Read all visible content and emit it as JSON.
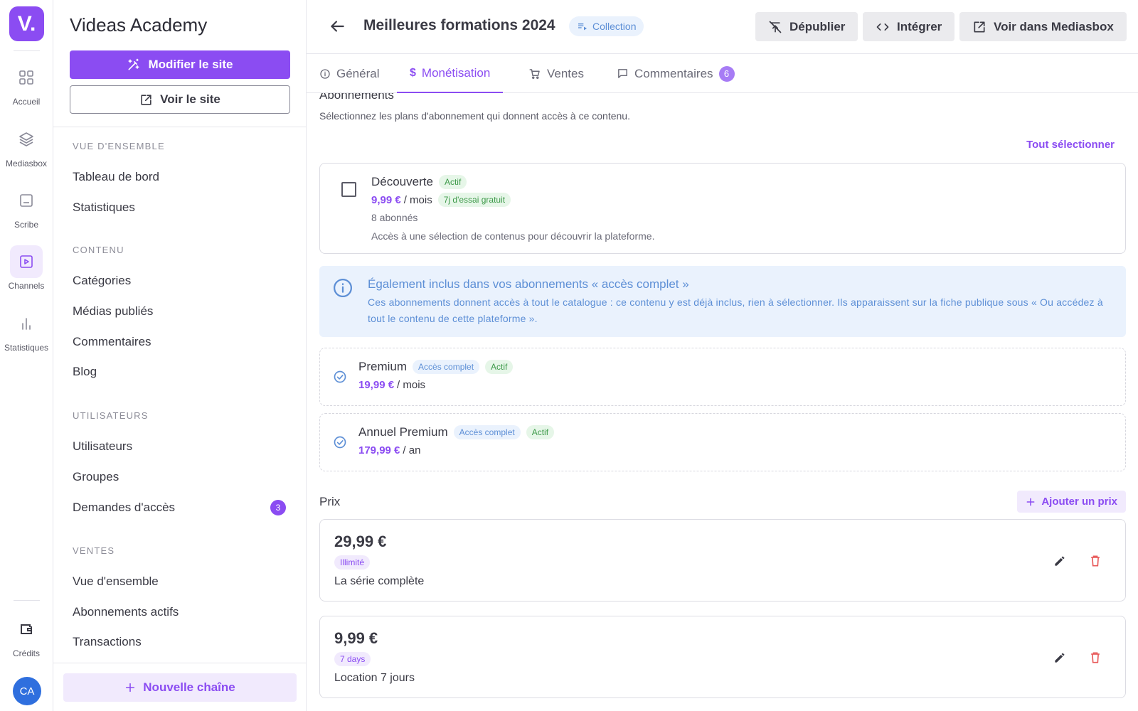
{
  "rail": {
    "logo": "V.",
    "items": [
      {
        "label": "Accueil",
        "icon": "grid-icon"
      },
      {
        "label": "Mediasbox",
        "icon": "layers-icon"
      },
      {
        "label": "Scribe",
        "icon": "caption-icon"
      },
      {
        "label": "Channels",
        "icon": "play-square-icon",
        "active": true
      },
      {
        "label": "Statistiques",
        "icon": "bar-chart-icon"
      }
    ],
    "credits_label": "Crédits",
    "avatar_initials": "CA"
  },
  "sidebar": {
    "site_title": "Videas Academy",
    "edit_site_label": "Modifier le site",
    "view_site_label": "Voir le site",
    "sections": [
      {
        "title": "VUE D'ENSEMBLE",
        "items": [
          "Tableau de bord",
          "Statistiques"
        ]
      },
      {
        "title": "CONTENU",
        "items": [
          "Catégories",
          "Médias publiés",
          "Commentaires",
          "Blog"
        ]
      },
      {
        "title": "UTILISATEURS",
        "items": [
          "Utilisateurs",
          "Groupes",
          "Demandes d'accès"
        ]
      },
      {
        "title": "VENTES",
        "items": [
          "Vue d'ensemble",
          "Abonnements actifs",
          "Transactions"
        ]
      }
    ],
    "access_requests_count": "3",
    "new_channel_label": "Nouvelle chaîne"
  },
  "header": {
    "title": "Meilleures formations 2024",
    "type_chip": "Collection",
    "unpublish_label": "Dépublier",
    "embed_label": "Intégrer",
    "view_in_mediasbox_label": "Voir dans Mediasbox"
  },
  "tabs": [
    {
      "label": "Général",
      "icon": "info-circle-icon"
    },
    {
      "label": "Monétisation",
      "icon": "dollar-icon",
      "active": true
    },
    {
      "label": "Ventes",
      "icon": "cart-icon"
    },
    {
      "label": "Commentaires",
      "icon": "comment-icon",
      "badge": "6"
    }
  ],
  "subscriptions": {
    "title": "Abonnements",
    "description": "Sélectionnez les plans d'abonnement qui donnent accès à ce contenu.",
    "select_all_label": "Tout sélectionner",
    "selectable_plan": {
      "name": "Découverte",
      "status": "Actif",
      "price": "9,99 €",
      "period": "/ mois",
      "trial": "7j d'essai gratuit",
      "subscribers": "8 abonnés",
      "description": "Accès à une sélection de contenus pour découvrir la plateforme.",
      "checked": false
    },
    "info": {
      "title": "Également inclus dans vos abonnements « accès complet »",
      "text": "Ces abonnements donnent accès à tout le catalogue : ce contenu y est déjà inclus, rien à sélectionner. Ils apparaissent sur la fiche publique sous « Ou accédez à tout le contenu de cette plateforme »."
    },
    "included_plans": [
      {
        "name": "Premium",
        "access": "Accès complet",
        "status": "Actif",
        "price": "19,99 €",
        "period": "/ mois"
      },
      {
        "name": "Annuel Premium",
        "access": "Accès complet",
        "status": "Actif",
        "price": "179,99 €",
        "period": "/ an"
      }
    ]
  },
  "prices": {
    "title": "Prix",
    "add_label": "Ajouter un prix",
    "items": [
      {
        "amount": "29,99 €",
        "duration": "Illimité",
        "description": "La série complète"
      },
      {
        "amount": "9,99 €",
        "duration": "7 days",
        "description": "Location 7 jours"
      }
    ]
  },
  "colors": {
    "accent": "#8b4cf2",
    "info": "#5d8fd6",
    "success": "#3e9a4a",
    "danger": "#e85a5a"
  }
}
